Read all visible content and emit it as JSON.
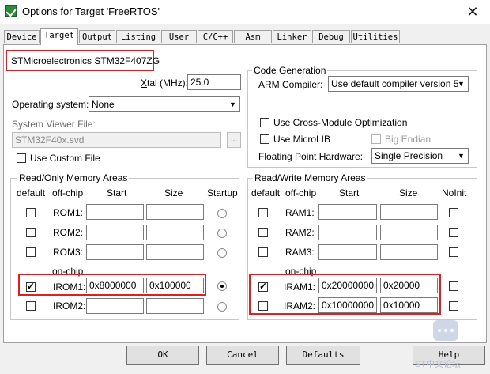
{
  "window": {
    "title": "Options for Target 'FreeRTOS'",
    "close_glyph": "✕"
  },
  "tabs": [
    "Device",
    "Target",
    "Output",
    "Listing",
    "User",
    "C/C++",
    "Asm",
    "Linker",
    "Debug",
    "Utilities"
  ],
  "active_tab": "Target",
  "device_name": "STMicroelectronics STM32F407ZG",
  "xtal": {
    "label_prefix": "",
    "label_x": "X",
    "label_rest": "tal (MHz):",
    "value": "25.0"
  },
  "os": {
    "label": "Operating system:",
    "value": "None"
  },
  "svf": {
    "label": "System Viewer File:",
    "value": "STM32F40x.svd",
    "browse": "..."
  },
  "custom_file": {
    "label": "Use Custom File",
    "checked": false
  },
  "codegen": {
    "title": "Code Generation",
    "compiler_label": "ARM Compiler:",
    "compiler_value": "Use default compiler version 5",
    "cross_module": "Use Cross-Module Optimization",
    "microlib": "Use MicroLIB",
    "big_endian": "Big Endian",
    "fp_label": "Floating Point Hardware:",
    "fp_value": "Single Precision"
  },
  "rom": {
    "title": "Read/Only Memory Areas",
    "headers": {
      "default": "default",
      "offchip": "off-chip",
      "start": "Start",
      "size": "Size",
      "startup": "Startup",
      "onchip": "on-chip"
    },
    "rows": [
      {
        "name": "ROM1:",
        "start": "",
        "size": "",
        "default": false,
        "startup": false
      },
      {
        "name": "ROM2:",
        "start": "",
        "size": "",
        "default": false,
        "startup": false
      },
      {
        "name": "ROM3:",
        "start": "",
        "size": "",
        "default": false,
        "startup": false
      },
      {
        "name": "IROM1:",
        "start": "0x8000000",
        "size": "0x100000",
        "default": true,
        "startup": true
      },
      {
        "name": "IROM2:",
        "start": "",
        "size": "",
        "default": false,
        "startup": false
      }
    ]
  },
  "ram": {
    "title": "Read/Write Memory Areas",
    "headers": {
      "default": "default",
      "offchip": "off-chip",
      "start": "Start",
      "size": "Size",
      "noinit": "NoInit",
      "onchip": "on-chip"
    },
    "rows": [
      {
        "name": "RAM1:",
        "start": "",
        "size": "",
        "default": false,
        "noinit": false
      },
      {
        "name": "RAM2:",
        "start": "",
        "size": "",
        "default": false,
        "noinit": false
      },
      {
        "name": "RAM3:",
        "start": "",
        "size": "",
        "default": false,
        "noinit": false
      },
      {
        "name": "IRAM1:",
        "start": "0x20000000",
        "size": "0x20000",
        "default": true,
        "noinit": false
      },
      {
        "name": "IRAM2:",
        "start": "0x10000000",
        "size": "0x10000",
        "default": false,
        "noinit": false
      }
    ]
  },
  "buttons": {
    "ok": "OK",
    "cancel": "Cancel",
    "defaults": "Defaults",
    "help": "Help"
  },
  "watermark": "ST中文论坛",
  "colors": {
    "highlight": "#e02020",
    "check_icon": "#2e8b3a"
  }
}
